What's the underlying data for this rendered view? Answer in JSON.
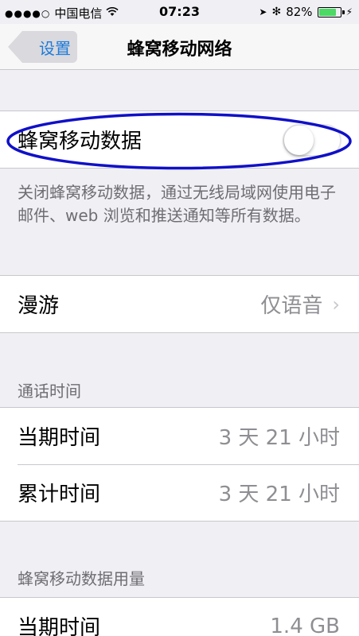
{
  "status_bar": {
    "signal": "●●●●○",
    "carrier": "中国电信",
    "wifi_icon": "wifi-icon",
    "time": "07:23",
    "location_icon": "➤",
    "bluetooth_icon": "✻",
    "battery_percent": "82%",
    "battery_level": 0.82,
    "charging_icon": "⚡"
  },
  "nav": {
    "back_label": "设置",
    "title": "蜂窝移动网络"
  },
  "cellular_data": {
    "label": "蜂窝移动数据",
    "enabled": false,
    "footer": "关闭蜂窝移动数据，通过无线局域网使用电子邮件、web 浏览和推送通知等所有数据。"
  },
  "roaming": {
    "label": "漫游",
    "value": "仅语音",
    "chevron": "›"
  },
  "call_time": {
    "header": "通话时间",
    "rows": [
      {
        "label": "当期时间",
        "value": "3 天 21 小时"
      },
      {
        "label": "累计时间",
        "value": "3 天 21 小时"
      }
    ]
  },
  "data_usage": {
    "header": "蜂窝移动数据用量",
    "rows": [
      {
        "label": "当期时间",
        "value": "1.4 GB"
      }
    ]
  },
  "colors": {
    "accent": "#1f7bd8",
    "annotation_oval": "#1010c8",
    "battery_green": "#4cd964"
  }
}
